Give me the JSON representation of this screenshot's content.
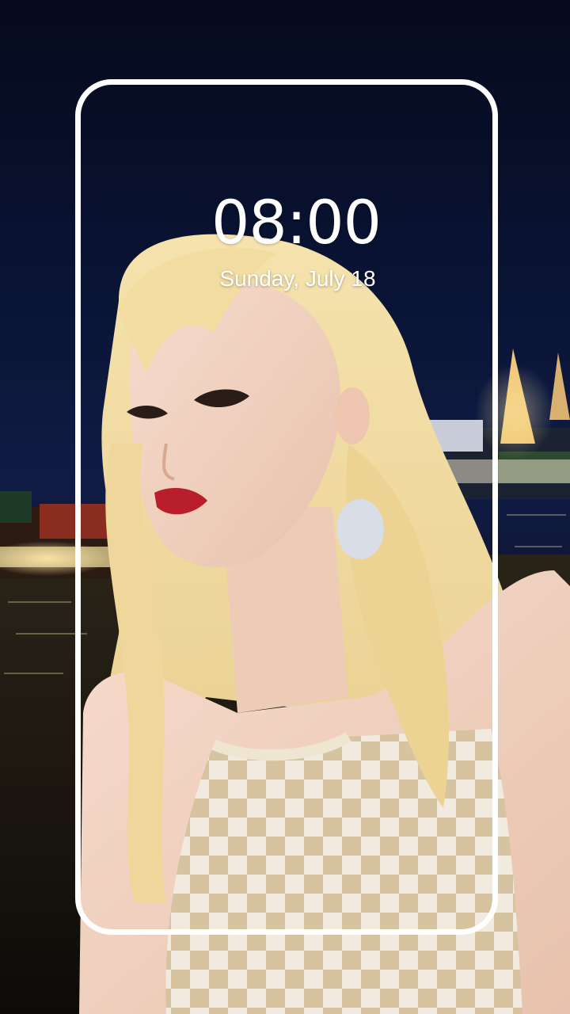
{
  "lockscreen": {
    "time": "08:00",
    "date": "Sunday, July 18"
  },
  "wallpaper": {
    "sky_color": "#0a1436",
    "hair_color": "#f0d79a",
    "top_colors": [
      "#f3eee4",
      "#d8c59e"
    ]
  },
  "frame": {
    "color": "#ffffff"
  }
}
